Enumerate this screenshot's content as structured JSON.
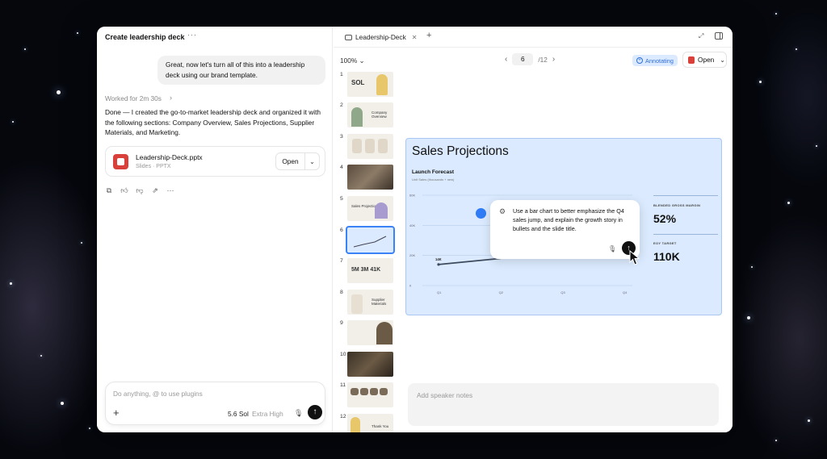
{
  "chat": {
    "title": "Create leadership deck",
    "more": "···",
    "user_message": "Great, now let's turn all of this into a leadership deck using our brand template.",
    "worked": "Worked for 2m 30s",
    "assistant_message": "Done — I created the go-to-market leadership deck and organized it with the following sections: Company Overview, Sales Projections, Supplier Materials, and Marketing.",
    "file": {
      "name": "Leadership-Deck.pptx",
      "sub": "Slides · PPTX",
      "open_label": "Open"
    },
    "reactions": [
      "copy-icon",
      "thumbs-up-icon",
      "thumbs-down-icon",
      "share-icon",
      "more-icon"
    ],
    "composer": {
      "placeholder": "Do anything, @ to use plugins",
      "model": "5.6 Sol",
      "effort": "Extra High"
    }
  },
  "viewer": {
    "tab_label": "Leadership-Deck",
    "zoom": "100%",
    "page_current": "6",
    "page_total": "/12",
    "annotating": "Annotating",
    "open_label": "Open",
    "notes_placeholder": "Add speaker notes",
    "thumbnails": [
      {
        "num": "1",
        "text": "SOL"
      },
      {
        "num": "2",
        "text": "Company Overview"
      },
      {
        "num": "3",
        "text": ""
      },
      {
        "num": "4",
        "text": ""
      },
      {
        "num": "5",
        "text": "Sales Projections"
      },
      {
        "num": "6",
        "text": ""
      },
      {
        "num": "7",
        "text": "5M  3M  41K"
      },
      {
        "num": "8",
        "text": "Supplier Materials"
      },
      {
        "num": "9",
        "text": ""
      },
      {
        "num": "10",
        "text": ""
      },
      {
        "num": "11",
        "text": ""
      },
      {
        "num": "12",
        "text": "Thank You"
      }
    ]
  },
  "slide": {
    "title": "Sales Projections",
    "chart_title": "Launch Forecast",
    "chart_subtitle": "Unit Sales (thousands + new)",
    "metric1_label": "BLENDED GROSS MARGIN",
    "metric1_value": "52%",
    "metric2_label": "EOY TARGET",
    "metric2_value": "110K",
    "comment": "Use a bar chart to better emphasize the Q4 sales jump, and explain the growth story in bullets and the slide title."
  },
  "chart_data": {
    "type": "line",
    "title": "Launch Forecast",
    "subtitle": "Unit Sales (thousands + new)",
    "categories": [
      "Q1",
      "Q2",
      "Q3",
      "Q4"
    ],
    "yticks": [
      "0",
      "20K",
      "40K",
      "60K"
    ],
    "ylim": [
      0,
      60
    ],
    "series": [
      {
        "values": [
          14,
          18,
          null,
          null
        ]
      }
    ],
    "point_label": "14K",
    "grid": true
  }
}
